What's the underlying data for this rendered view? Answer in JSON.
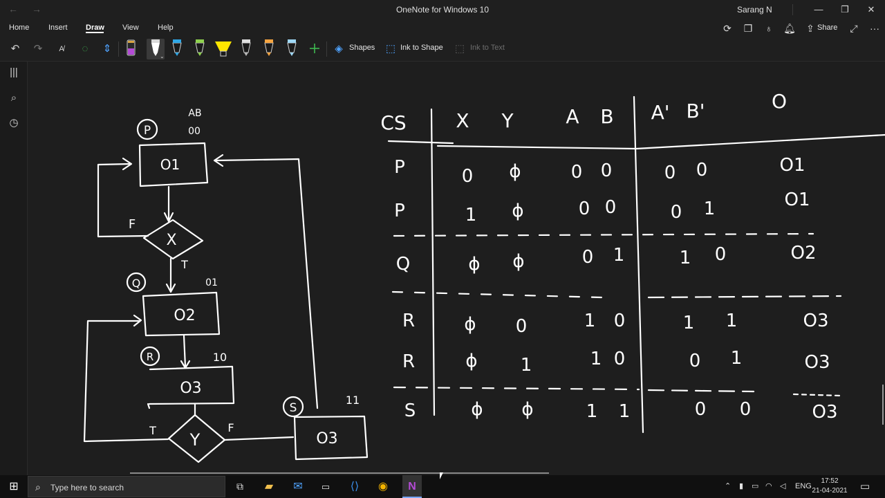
{
  "window": {
    "title": "OneNote for Windows 10",
    "user": "Sarang N",
    "nav_back": "←",
    "nav_forward": "→",
    "min": "—",
    "max": "❐",
    "close": "✕"
  },
  "tabs": [
    "Home",
    "Insert",
    "Draw",
    "View",
    "Help"
  ],
  "active_tab": "Draw",
  "ribbon_right": {
    "share_label": "Share",
    "more": "···"
  },
  "toolbar": {
    "shapes_label": "Shapes",
    "ink_to_shape_label": "Ink to Shape",
    "ink_to_text_label": "Ink to Text",
    "pens": [
      {
        "name": "pen-purple",
        "color": "#b44bd6"
      },
      {
        "name": "pen-white",
        "color": "#ffffff"
      },
      {
        "name": "pen-blue",
        "color": "#2fa7e6"
      },
      {
        "name": "pen-green",
        "color": "#8fd14f"
      },
      {
        "name": "highlighter-yellow",
        "color": "#ffe600"
      },
      {
        "name": "pen-gray",
        "color": "#b9b9b9"
      },
      {
        "name": "pen-orange",
        "color": "#f7a541"
      },
      {
        "name": "pen-lightblue",
        "color": "#9fd8f7"
      }
    ]
  },
  "note": {
    "flowchart": {
      "states": [
        "P",
        "Q",
        "R",
        "S"
      ],
      "state_codes": {
        "AB": "AB",
        "P": "00",
        "Q": "01",
        "R": "10",
        "S": "11"
      },
      "boxes": [
        "O1",
        "O2",
        "O3",
        "O3"
      ],
      "decisions": [
        "X",
        "Y"
      ],
      "branch_labels": {
        "x_false": "F",
        "x_true": "T",
        "y_true": "T",
        "y_false": "F"
      }
    },
    "table": {
      "headers": [
        "CS",
        "X",
        "Y",
        "A",
        "B",
        "A'",
        "B'",
        "O"
      ],
      "rows": [
        [
          "P",
          "0",
          "ϕ",
          "0",
          "0",
          "0",
          "0",
          "O1"
        ],
        [
          "P",
          "1",
          "ϕ",
          "0",
          "0",
          "0",
          "1",
          "O1"
        ],
        [
          "Q",
          "ϕ",
          "ϕ",
          "0",
          "1",
          "1",
          "0",
          "O2"
        ],
        [
          "R",
          "ϕ",
          "0",
          "1",
          "0",
          "1",
          "1",
          "O3"
        ],
        [
          "R",
          "ϕ",
          "1",
          "1",
          "0",
          "0",
          "1",
          "O3"
        ],
        [
          "S",
          "ϕ",
          "ϕ",
          "1",
          "1",
          "0",
          "0",
          "O3"
        ]
      ]
    }
  },
  "taskbar": {
    "search_placeholder": "Type here to search",
    "lang": "ENG",
    "time": "17:52",
    "date": "21-04-2021"
  }
}
